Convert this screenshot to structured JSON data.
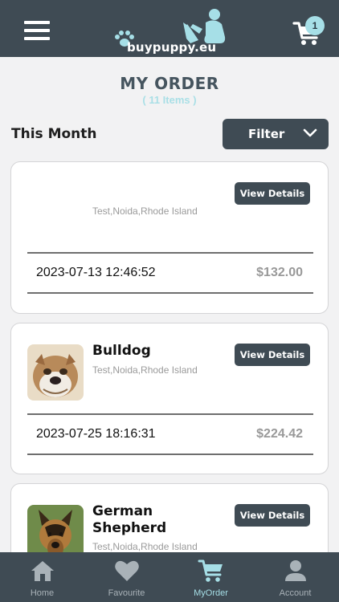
{
  "header": {
    "logo_text": "buypuppy.eu",
    "cart_count": "1",
    "colors": {
      "bar": "#3f4b54",
      "accent": "#a6dfe7"
    }
  },
  "page": {
    "title": "MY ORDER",
    "count": "( 11 Items )"
  },
  "section": {
    "title": "This Month",
    "filter_label": "Filter"
  },
  "orders": [
    {
      "name": "",
      "address": "Test,Noida,Rhode Island",
      "details_label": "View Details",
      "datetime": "2023-07-13 12:46:52",
      "price": "$132.00",
      "image": "none"
    },
    {
      "name": "Bulldog",
      "address": "Test,Noida,Rhode Island",
      "details_label": "View Details",
      "datetime": "2023-07-25 18:16:31",
      "price": "$224.42",
      "image": "bulldog-photo"
    },
    {
      "name": "German Shepherd",
      "address": "Test,Noida,Rhode Island",
      "details_label": "View Details",
      "datetime": "",
      "price": "",
      "image": "german-shepherd-photo"
    }
  ],
  "tabs": [
    {
      "label": "Home",
      "icon": "home-icon",
      "active": false
    },
    {
      "label": "Favourite",
      "icon": "heart-icon",
      "active": false
    },
    {
      "label": "MyOrder",
      "icon": "cart-icon",
      "active": true
    },
    {
      "label": "Account",
      "icon": "account-icon",
      "active": false
    }
  ]
}
